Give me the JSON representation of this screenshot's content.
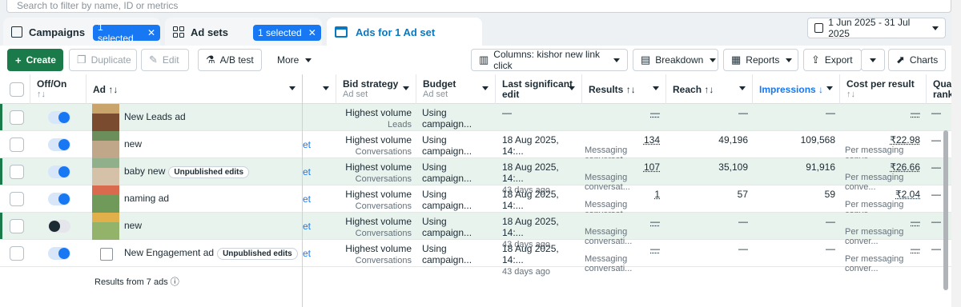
{
  "search": {
    "placeholder": "Search to filter by name, ID or metrics"
  },
  "tabs": {
    "campaigns": {
      "label": "Campaigns",
      "chip": "1 selected"
    },
    "adsets": {
      "label": "Ad sets",
      "chip": "1 selected"
    },
    "ads": {
      "label": "Ads for 1 Ad set"
    }
  },
  "date_range": "1 Jun 2025 - 31 Jul 2025",
  "toolbar": {
    "create": "Create",
    "duplicate": "Duplicate",
    "edit": "Edit",
    "ab_test": "A/B test",
    "more": "More",
    "columns": "Columns: kishor new link click",
    "breakdown": "Breakdown",
    "reports": "Reports",
    "export": "Export",
    "charts": "Charts"
  },
  "columns": {
    "off_on": "Off/On",
    "ad": "Ad",
    "bid_strategy": "Bid strategy",
    "bid_strategy_sub": "Ad set",
    "budget": "Budget",
    "budget_sub": "Ad set",
    "last_edit_1": "Last significant",
    "last_edit_2": "edit",
    "results": "Results",
    "reach": "Reach",
    "impressions": "Impressions",
    "cost_per_result": "Cost per result",
    "quality_1": "Qua",
    "quality_2": "rank"
  },
  "rows": [
    {
      "name": "New Leads ad",
      "badge": "",
      "on": true,
      "bid": "Highest volume",
      "bid_sub": "Leads",
      "budget": "Using campaign...",
      "edit": "—",
      "edit_sub": "",
      "results": "—",
      "results_sub": "",
      "reach": "—",
      "impressions": "—",
      "cost": "—",
      "cost_sub": "",
      "quality": "—",
      "link": ""
    },
    {
      "name": "new",
      "badge": "",
      "on": true,
      "bid": "Highest volume",
      "bid_sub": "Conversations",
      "budget": "Using campaign...",
      "edit": "18 Aug 2025, 14:...",
      "edit_sub": "43 days ago",
      "results": "134",
      "results_sub": "Messaging conversat...",
      "reach": "49,196",
      "impressions": "109,568",
      "cost": "₹22.98",
      "cost_sub": "Per messaging conve...",
      "quality": "—",
      "link": "et"
    },
    {
      "name": "baby new",
      "badge": "Unpublished edits",
      "on": true,
      "bid": "Highest volume",
      "bid_sub": "Conversations",
      "budget": "Using campaign...",
      "edit": "18 Aug 2025, 14:...",
      "edit_sub": "43 days ago",
      "results": "107",
      "results_sub": "Messaging conversat...",
      "reach": "35,109",
      "impressions": "91,916",
      "cost": "₹26.66",
      "cost_sub": "Per messaging conve...",
      "quality": "—",
      "link": "et"
    },
    {
      "name": "naming ad",
      "badge": "",
      "on": true,
      "bid": "Highest volume",
      "bid_sub": "Conversations",
      "budget": "Using campaign...",
      "edit": "18 Aug 2025, 14:...",
      "edit_sub": "43 days ago",
      "results": "1",
      "results_sub": "Messaging conversat...",
      "reach": "57",
      "impressions": "59",
      "cost": "₹2.04",
      "cost_sub": "Per messaging conve...",
      "quality": "—",
      "link": "et"
    },
    {
      "name": "new",
      "badge": "",
      "on": false,
      "bid": "Highest volume",
      "bid_sub": "Conversations",
      "budget": "Using campaign...",
      "edit": "18 Aug 2025, 14:...",
      "edit_sub": "43 days ago",
      "results": "—",
      "results_sub": "Messaging conversati...",
      "reach": "—",
      "impressions": "—",
      "cost": "—",
      "cost_sub": "Per messaging conver...",
      "quality": "—",
      "link": "et"
    },
    {
      "name": "New Engagement ad",
      "badge": "Unpublished edits",
      "on": true,
      "bid": "Highest volume",
      "bid_sub": "Conversations",
      "budget": "Using campaign...",
      "edit": "18 Aug 2025, 14:...",
      "edit_sub": "43 days ago",
      "results": "—",
      "results_sub": "Messaging conversati...",
      "reach": "—",
      "impressions": "—",
      "cost": "—",
      "cost_sub": "Per messaging conver...",
      "quality": "—",
      "link": "et"
    }
  ],
  "footer": "Results from 7 ads",
  "colors": {
    "accent": "#1877f2",
    "create_green": "#1b7a49",
    "row_highlight": "#e9f3ee"
  }
}
